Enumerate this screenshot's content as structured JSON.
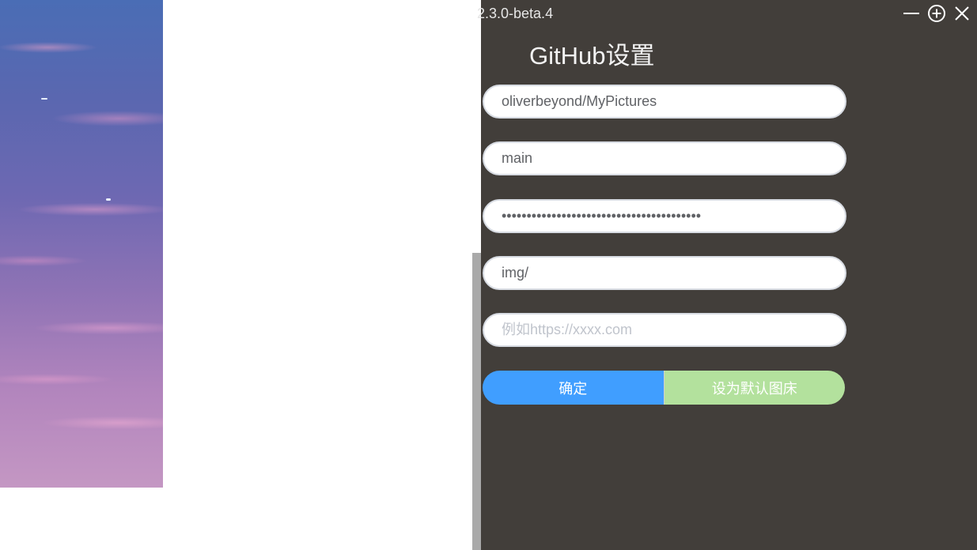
{
  "window": {
    "version": "2.3.0-beta.4",
    "controls": {
      "minimize_icon": "minimize-icon",
      "maximize_icon": "plus-circle-icon",
      "close_icon": "close-icon"
    }
  },
  "settings": {
    "title": "GitHub设置",
    "fields": {
      "repo": {
        "value": "oliverbeyond/MyPictures",
        "placeholder": ""
      },
      "branch": {
        "value": "main",
        "placeholder": ""
      },
      "token": {
        "value": "••••••••••••••••••••••••••••••••••••••••",
        "placeholder": ""
      },
      "path": {
        "value": "img/",
        "placeholder": ""
      },
      "custom_url": {
        "value": "",
        "placeholder": "例如https://xxxx.com"
      }
    },
    "buttons": {
      "confirm": "确定",
      "set_default": "设为默认图床"
    }
  },
  "colors": {
    "panel_bg": "#423e3a",
    "primary": "#409eff",
    "success_light": "#b3e19d",
    "input_border": "#d8dce3"
  }
}
